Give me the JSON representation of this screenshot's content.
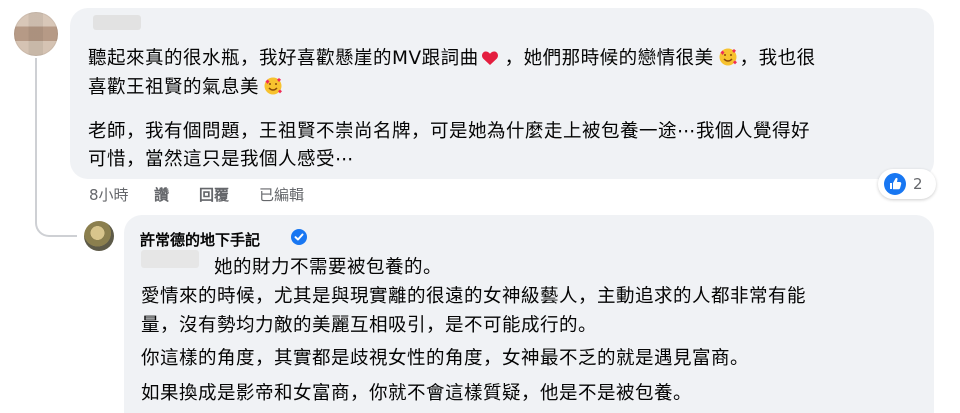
{
  "comment1": {
    "line1_a": "聽起來真的很水瓶，我好喜歡懸崖的MV跟詞曲",
    "line1_b": "，她們那時候的戀情很美",
    "line1_c": "，我也很",
    "line2": "喜歡王祖賢的氣息美",
    "line3": "老師，我有個問題，王祖賢不崇尚名牌，可是她為什麼走上被包養一途⋯我個人覺得好",
    "line4": "可惜，當然這只是我個人感受⋯",
    "meta": {
      "time": "8小時",
      "like": "讚",
      "reply": "回覆",
      "edited": "已編輯"
    },
    "reaction_count": "2"
  },
  "reply": {
    "author": "許常德的地下手記",
    "line1": "她的財力不需要被包養的。",
    "line2": "愛情來的時候，尤其是與現實離的很遠的女神級藝人，主動追求的人都非常有能",
    "line3": "量，沒有勢均力敵的美麗互相吸引，是不可能成行的。",
    "line4": "你這樣的角度，其實都是歧視女性的角度，女神最不乏的就是遇見富商。",
    "line5": "如果換成是影帝和女富商，你就不會這樣質疑，他是不是被包養。"
  },
  "colors": {
    "bubble": "#f0f2f5",
    "meta_text": "#65676b",
    "accent_blue": "#1877f2",
    "heart": "#e41e3f"
  },
  "icons": [
    "heart-icon",
    "smiling-face-with-hearts-icon",
    "like-reaction-icon",
    "verified-badge-icon"
  ]
}
